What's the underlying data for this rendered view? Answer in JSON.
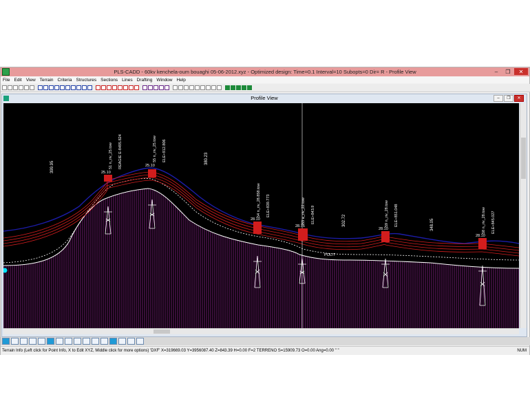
{
  "app": {
    "title": "PLS-CADD - 60kv kenchela-oum bouaghi    05-06-2012.xyz - Optimized design: Time=0.1 Interval=10 Subopts=0 Dir= R - Profile View",
    "window_buttons": [
      "–",
      "❐",
      "✕"
    ]
  },
  "menu": [
    "File",
    "Edit",
    "View",
    "Terrain",
    "Criteria",
    "Structures",
    "Sections",
    "Lines",
    "Drafting",
    "Window",
    "Help"
  ],
  "toolbar": {
    "groups": [
      [
        "new",
        "open",
        "save",
        "print",
        "copy",
        "paste"
      ],
      [
        "zoom-in",
        "zoom-out",
        "zoom-add",
        "zoom-window",
        "zoom-pan",
        "undo",
        "redo",
        "refresh",
        "find",
        "tools"
      ],
      [
        "struct-1",
        "struct-2",
        "struct-3",
        "struct-4",
        "struct-5",
        "struct-6",
        "struct-7",
        "struct-8"
      ],
      [
        "sag-1",
        "sag-2",
        "sag-3",
        "sag-4",
        "sag-5"
      ],
      [
        "pct-1",
        "pct-2",
        "pct-3",
        "pct-4",
        "pct-5",
        "pct-6",
        "pct-7",
        "pct-8",
        "pct-9"
      ],
      [
        "view-1",
        "view-2",
        "view-3",
        "view-4",
        "view-5"
      ]
    ]
  },
  "profile_window": {
    "title": "Profile View",
    "buttons": [
      "–",
      "❐",
      "✕"
    ]
  },
  "profile": {
    "span_labels": [
      "399.95",
      "380.23",
      "302.72",
      "348.05"
    ],
    "structures": [
      {
        "id": "s1",
        "elev": "25.10",
        "label": "51 n_riv_25.tow",
        "sub": "REAGIE E-8495.824"
      },
      {
        "id": "s2",
        "elev": "25.10",
        "label": "55 n_riv_25.tow",
        "sub": "ELE+912.806"
      },
      {
        "id": "s3",
        "elev": "28.10",
        "label": "54 n_riv_28.858.tow",
        "sub": "ELE+839.773"
      },
      {
        "id": "s4",
        "elev": "28.75",
        "label": "53 a_riv_22.tow",
        "sub": "ELE+843.9"
      },
      {
        "id": "s5",
        "elev": "28.10",
        "label": "59 n_riv_28.tow",
        "sub": "ELE+851.048"
      },
      {
        "id": "s6",
        "elev": "28.10",
        "label": "58 n_riv_28.tow",
        "sub": "ELE+845.027"
      }
    ],
    "marker": "POLIT"
  },
  "status": {
    "message": "Terrain Info (Left click for Point Info, X to Edit XYZ, Middle click for more options) 'DXF' X=319669.03 Y=3956087.40 Z=843.39 H=0.00 F=2 TERRENO S=15909.73 O=0.00 Ang=0.00 \" \"",
    "num": "NUM"
  },
  "colors": {
    "plot_bg": "#000000",
    "ground": "#ffffff",
    "clearance": "#1c1ca8",
    "conductor": "#d11d1d",
    "hatch": "#6e1d6e",
    "accent": "#00e5ff"
  }
}
